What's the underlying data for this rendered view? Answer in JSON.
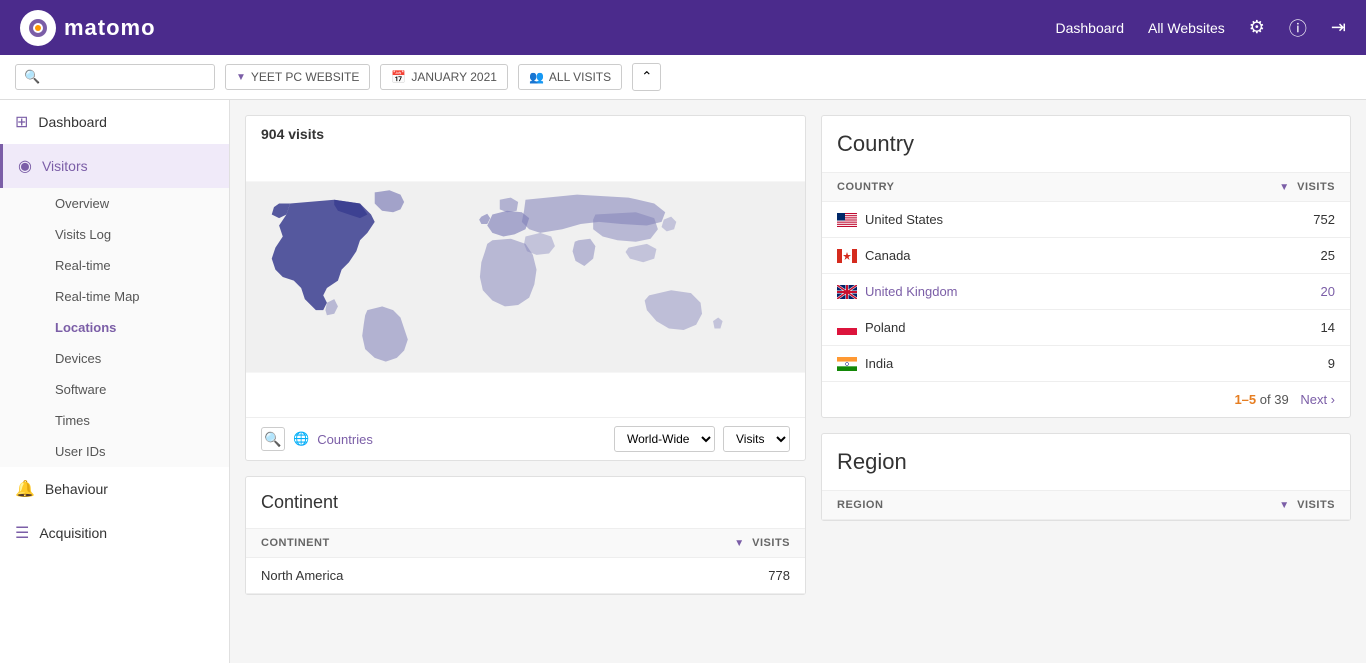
{
  "topnav": {
    "logo_text": "matomo",
    "dashboard_label": "Dashboard",
    "all_websites_label": "All Websites"
  },
  "toolbar": {
    "search_placeholder": "",
    "website_label": "YEET PC WEBSITE",
    "date_label": "JANUARY 2021",
    "visits_label": "ALL VISITS",
    "collapse_icon": "⌃"
  },
  "sidebar": {
    "dashboard_label": "Dashboard",
    "visitors_label": "Visitors",
    "sub_items": [
      {
        "label": "Overview",
        "active": false
      },
      {
        "label": "Visits Log",
        "active": false
      },
      {
        "label": "Real-time",
        "active": false
      },
      {
        "label": "Real-time Map",
        "active": false
      },
      {
        "label": "Locations",
        "active": true
      },
      {
        "label": "Devices",
        "active": false
      },
      {
        "label": "Software",
        "active": false
      },
      {
        "label": "Times",
        "active": false
      },
      {
        "label": "User IDs",
        "active": false
      }
    ],
    "behaviour_label": "Behaviour",
    "acquisition_label": "Acquisition"
  },
  "map_widget": {
    "title": "904 visits",
    "countries_link": "Countries",
    "region_select": "World-Wide",
    "metric_select": "Visits"
  },
  "continent_widget": {
    "title": "Continent",
    "col_continent": "CONTINENT",
    "col_visits": "VISITS",
    "rows": [
      {
        "continent": "North America",
        "visits": "778"
      }
    ]
  },
  "country_widget": {
    "title": "Country",
    "col_country": "COUNTRY",
    "col_visits": "VISITS",
    "rows": [
      {
        "country": "United States",
        "visits": "752",
        "flag": "us"
      },
      {
        "country": "Canada",
        "visits": "25",
        "flag": "ca"
      },
      {
        "country": "United Kingdom",
        "visits": "20",
        "flag": "uk"
      },
      {
        "country": "Poland",
        "visits": "14",
        "flag": "pl"
      },
      {
        "country": "India",
        "visits": "9",
        "flag": "in"
      }
    ],
    "pagination": {
      "current_start": "1",
      "current_end": "5",
      "total": "39",
      "next_label": "Next ›"
    }
  },
  "region_widget": {
    "title": "Region",
    "col_region": "REGION",
    "col_visits": "VISITS"
  },
  "scrollbar": {
    "present": true
  }
}
